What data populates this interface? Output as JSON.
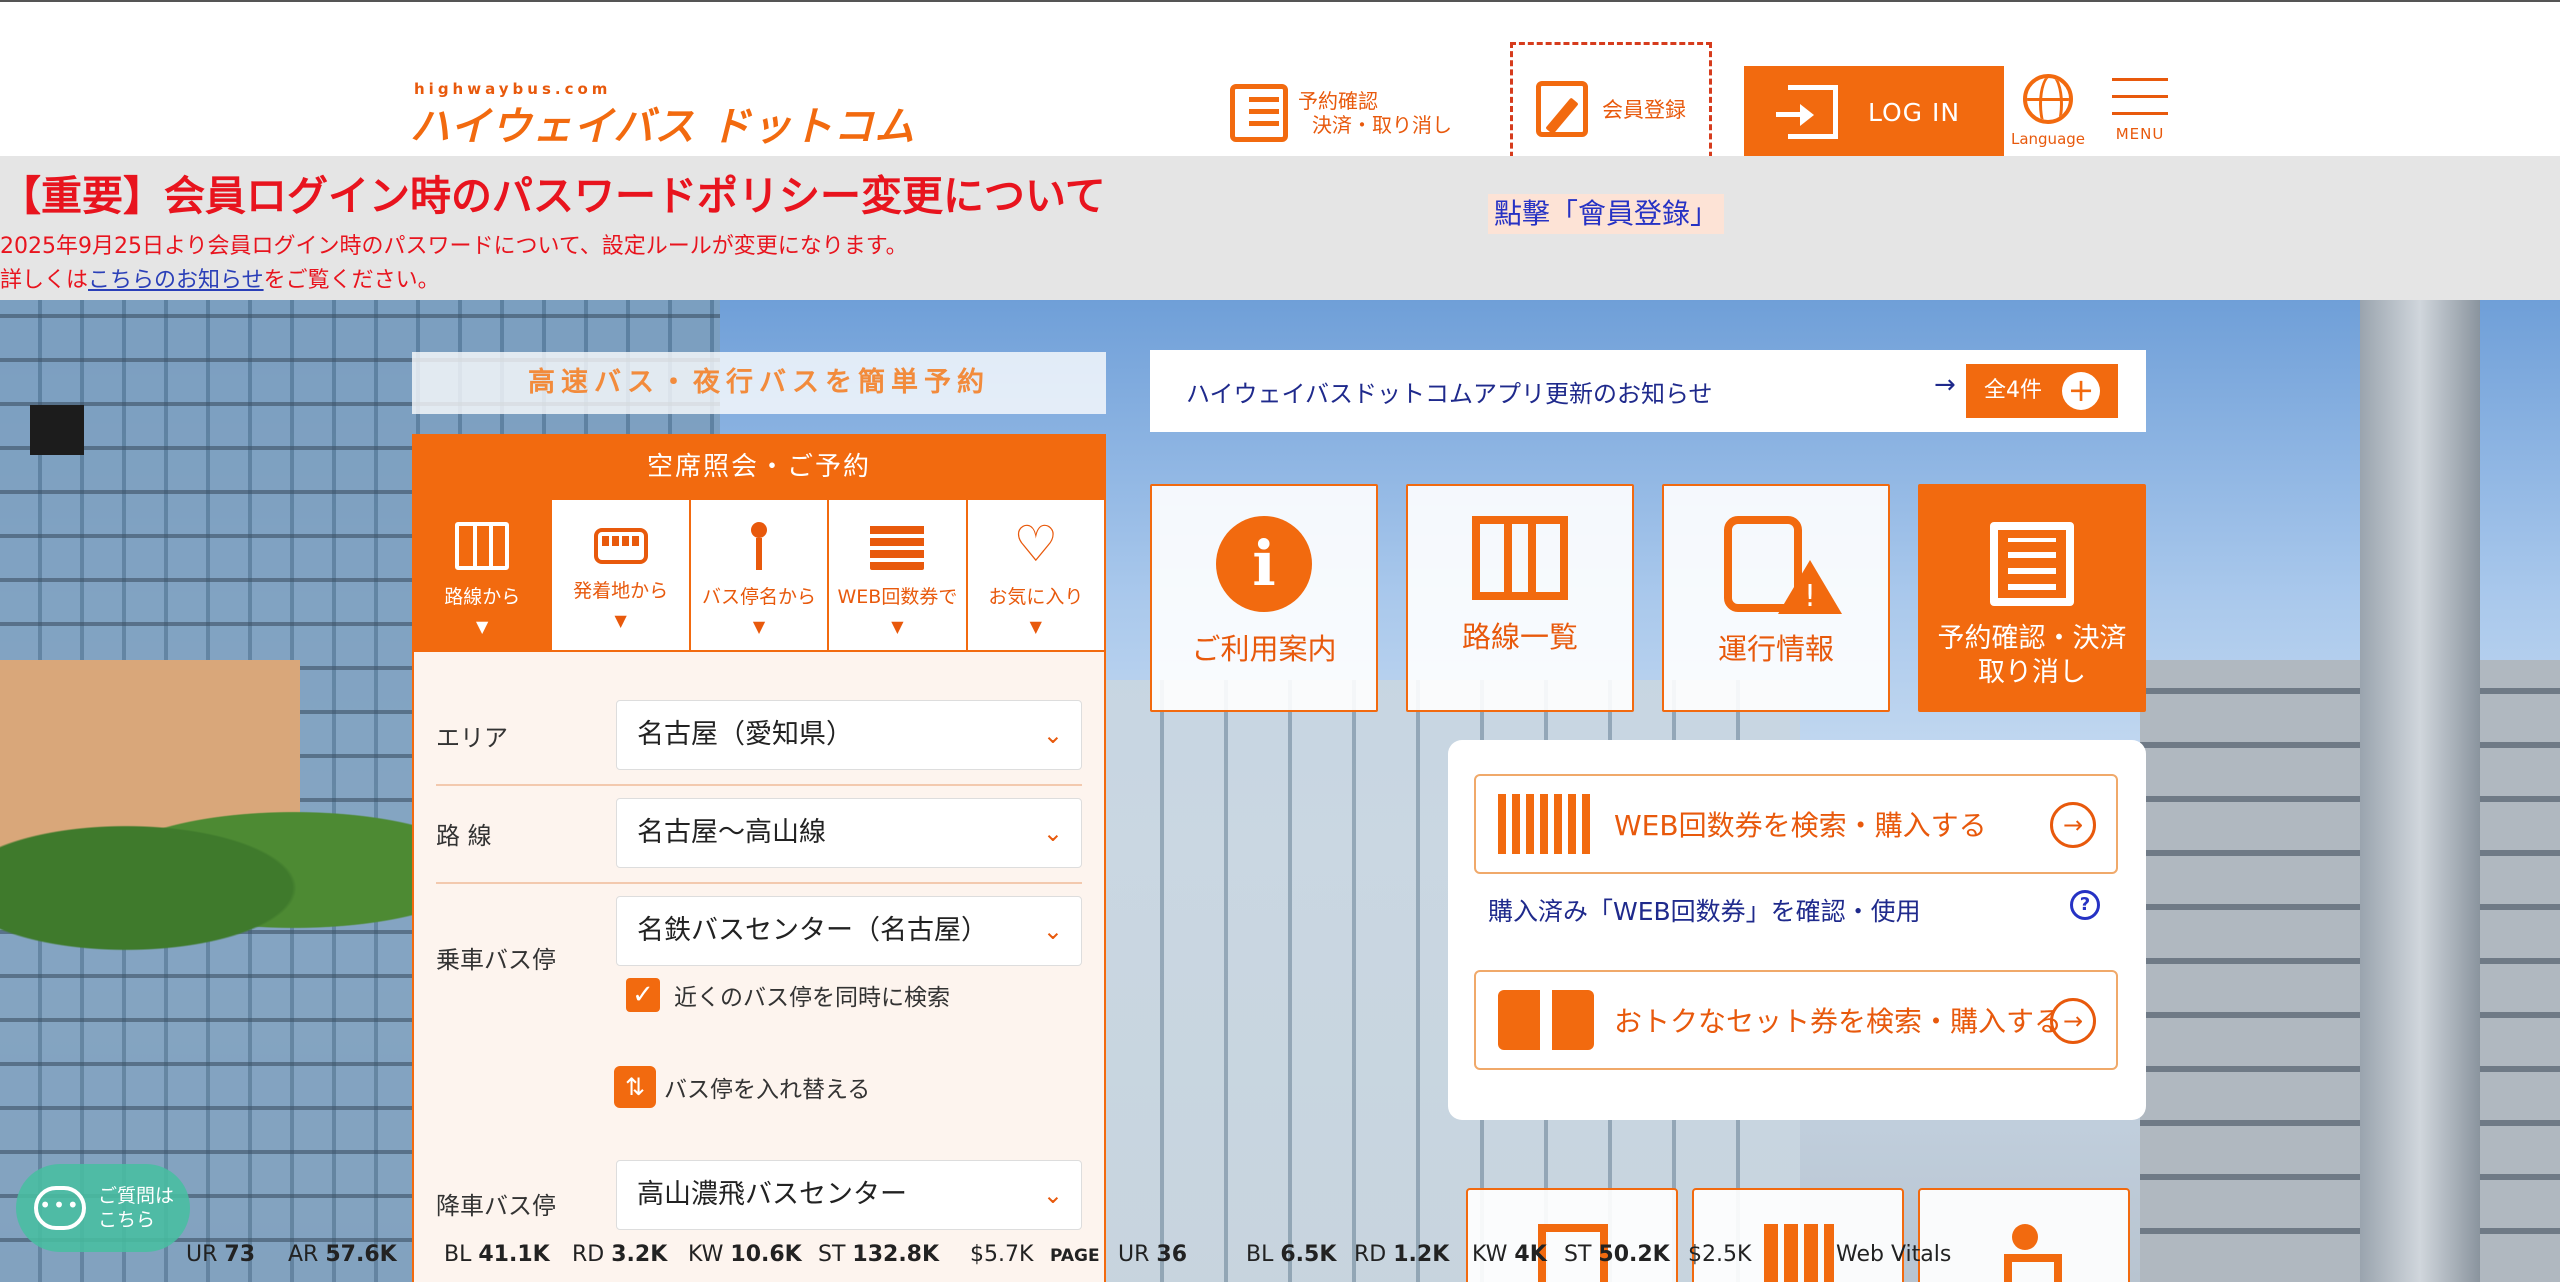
{
  "header": {
    "logo_small": "highwaybus.com",
    "logo_main": "ハイウェイバス ドットコム",
    "reserve_line1": "予約確認",
    "reserve_line2": "決済・取り消し",
    "register_label": "会員登録",
    "login_label": "LOG IN",
    "language_label": "Language",
    "menu_label": "MENU"
  },
  "tooltip": "點擊「會員登錄」",
  "notice": {
    "title": "【重要】会員ログイン時のパスワードポリシー変更について",
    "line1": "2025年9月25日より会員ログイン時のパスワードについて、設定ルールが変更になります。",
    "line2_prefix": "詳しくは",
    "line2_link": "こちらのお知らせ",
    "line2_suffix": "をご覧ください。"
  },
  "search": {
    "tagline": "高速バス・夜行バスを簡単予約",
    "panel_title": "空席照会・ご予約",
    "tabs": [
      {
        "label": "路線から",
        "icon": "map-icon"
      },
      {
        "label": "発着地から",
        "icon": "bus-icon"
      },
      {
        "label": "バス停名から",
        "icon": "bus-stop-icon"
      },
      {
        "label": "WEB回数券で",
        "icon": "ticket-icon"
      },
      {
        "label": "お気に入り",
        "icon": "heart-icon"
      }
    ],
    "tab_arrow": "▼",
    "area_label": "エリア",
    "area_value": "名古屋（愛知県）",
    "route_label": "路 線",
    "route_value": "名古屋～高山線",
    "board_label": "乗車バス停",
    "board_value": "名鉄バスセンター（名古屋）",
    "nearby_label": "近くのバス停を同時に検索",
    "nearby_checked": "✓",
    "swap_label": "バス停を入れ替える",
    "swap_glyph": "⇅",
    "alight_label": "降車バス停",
    "alight_value": "高山濃飛バスセンター",
    "chevron": "⌄"
  },
  "news": {
    "text": "ハイウェイバスドットコムアプリ更新のお知らせ",
    "arrow": "→",
    "all_label": "全4件",
    "plus": "+"
  },
  "tiles": [
    {
      "label": "ご利用案内",
      "icon": "info-icon"
    },
    {
      "label": "路線一覧",
      "icon": "map-icon"
    },
    {
      "label": "運行情報",
      "icon": "bus-alert-icon"
    },
    {
      "label1": "予約確認・決済",
      "label2": "取り消し",
      "icon": "list-icon"
    }
  ],
  "info_glyph": "i",
  "card": {
    "web_ticket_label": "WEB回数券を検索・購入する",
    "purchased_link": "購入済み「WEB回数券」を確認・使用",
    "help_glyph": "?",
    "set_ticket_label": "おトクなセット券を検索・購入する",
    "go_glyph": "→"
  },
  "chat": {
    "bubble": "•••",
    "line1": "ご質問は",
    "line2": "こちら"
  },
  "vitals": {
    "site_ur_label": "UR",
    "site_ur": "73",
    "site_ar_label": "AR",
    "site_ar": "57.6K",
    "site_bl_label": "BL",
    "site_bl": "41.1K",
    "site_rd_label": "RD",
    "site_rd": "3.2K",
    "site_kw_label": "KW",
    "site_kw": "10.6K",
    "site_st_label": "ST",
    "site_st": "132.8K",
    "site_cost": "$5.7K",
    "page_label": "PAGE",
    "page_ur_label": "UR",
    "page_ur": "36",
    "page_bl_label": "BL",
    "page_bl": "6.5K",
    "page_rd_label": "RD",
    "page_rd": "1.2K",
    "page_kw_label": "KW",
    "page_kw": "4K",
    "page_st_label": "ST",
    "page_st": "50.2K",
    "page_cost": "$2.5K",
    "web_vitals": "Web Vitals"
  },
  "colors": {
    "accent": "#f26a0f",
    "notice_red": "#e8141e",
    "link_blue": "#1f2a8c",
    "notice_bg": "#e5e5e5"
  }
}
